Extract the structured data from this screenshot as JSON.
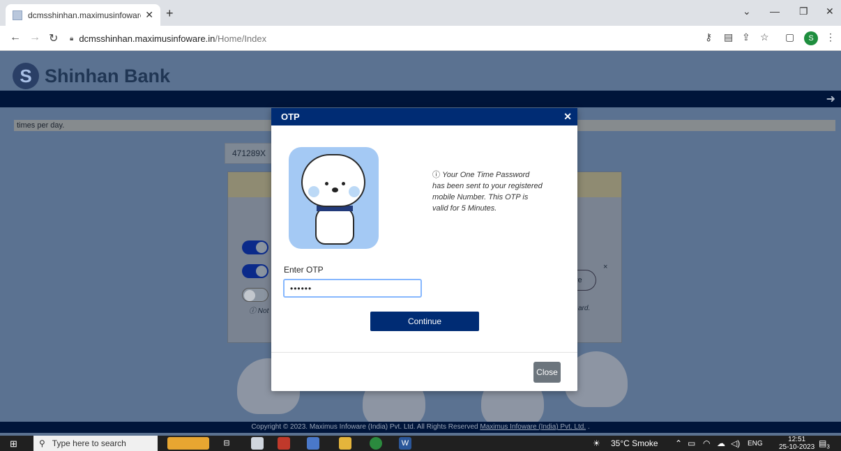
{
  "browser": {
    "tab_title": "dcmsshinhan.maximusinfoware.in",
    "url_host": "dcmsshinhan.maximusinfoware.in",
    "url_path": "/Home/Index",
    "profile_initial": "S"
  },
  "page": {
    "bank_name": "Shinhan Bank",
    "marquee_text": "times per day.",
    "masked_card": "471289X",
    "bg_save_partial": "ve",
    "bg_note_left": "Not",
    "bg_note_right": "ard.",
    "copyright_text": "Copyright © 2023. Maximus Infoware (India) Pvt. Ltd. All Rights Reserved ",
    "copyright_link": "Maximus Infoware (India) Pvt. Ltd."
  },
  "otp_modal": {
    "title": "OTP",
    "info_message": "Your One Time Password has been sent to your registered mobile Number. This OTP is valid for 5 Minutes.",
    "otp_label": "Enter OTP",
    "otp_value": "••••••",
    "continue_label": "Continue",
    "close_label": "Close"
  },
  "taskbar": {
    "search_placeholder": "Type here to search",
    "weather": "35°C  Smoke",
    "language": "ENG",
    "time": "12:51",
    "date": "25-10-2023",
    "notifications": "3"
  },
  "colors": {
    "brand_navy": "#002c74",
    "close_gray": "#6c757d",
    "input_focus": "#86b7fe"
  }
}
